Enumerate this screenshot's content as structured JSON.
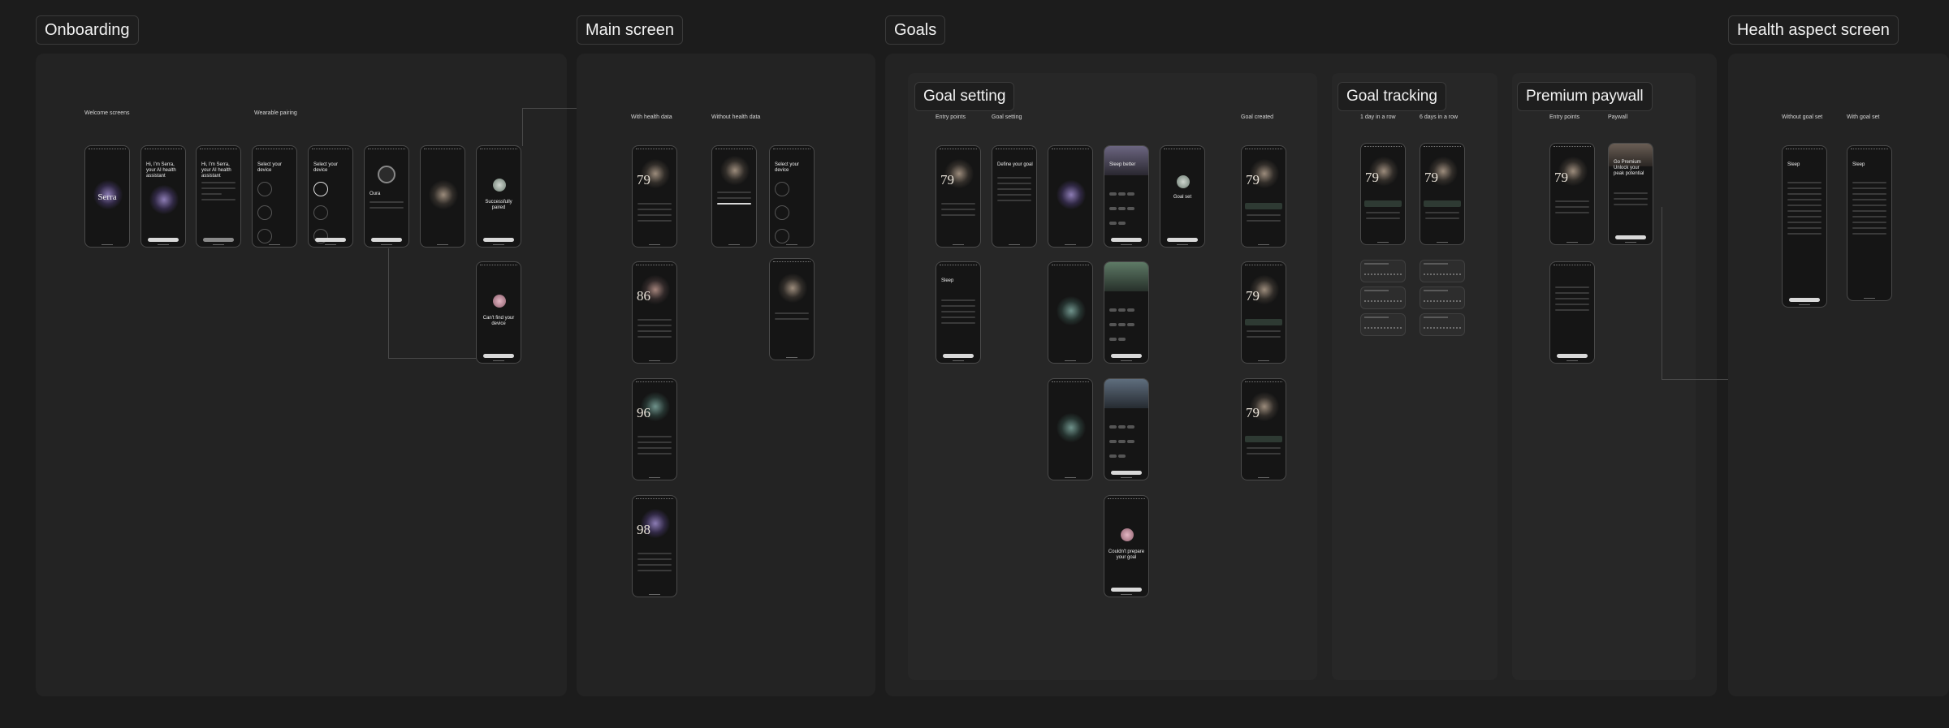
{
  "canvas": {
    "background": "#1c1c1c",
    "panel": "#232323",
    "tag_border": "#3a3a3a"
  },
  "sections": {
    "onboarding": {
      "title": "Onboarding",
      "captions": {
        "welcome": "Welcome screens",
        "wearable": "Wearable pairing"
      },
      "screens": {
        "wordmark": "Serra",
        "hi": "Hi, I'm Serra, your AI health assistant",
        "hi2": "Hi, I'm Serra, your AI health assistant",
        "select1": "Select your device",
        "select2": "Select your device",
        "oura": "Oura",
        "paired": "Successfully paired",
        "cant_find": "Can't find your device"
      }
    },
    "main": {
      "title": "Main screen",
      "captions": {
        "with": "With health data",
        "without": "Without health data"
      },
      "screens": {
        "score1": "79",
        "score2": "86",
        "score3": "96",
        "score4": "98",
        "select": "Select your device"
      }
    },
    "goals": {
      "title": "Goals",
      "goal_setting": {
        "title": "Goal setting",
        "captions": {
          "entry": "Entry points",
          "setting": "Goal setting",
          "created": "Goal created"
        },
        "screens": {
          "score": "79",
          "define": "Define your goal",
          "sleep": "Sleep better",
          "goal_set": "Goal set",
          "sleep_card": "Sleep",
          "couldnt": "Couldn't prepare your goal",
          "score_created": "79"
        }
      },
      "goal_tracking": {
        "title": "Goal tracking",
        "captions": {
          "one_day": "1 day in a row",
          "six_days": "6 days in a row"
        },
        "screens": {
          "score1": "79",
          "score2": "79"
        }
      },
      "premium": {
        "title": "Premium paywall",
        "captions": {
          "entry": "Entry points",
          "paywall": "Paywall"
        },
        "screens": {
          "score": "79",
          "go_premium": "Go Premium Unlock your peak potential"
        }
      }
    },
    "health_aspect": {
      "title": "Health aspect screen",
      "captions": {
        "without": "Without goal set",
        "with": "With goal set"
      },
      "screens": {
        "sleep1": "Sleep",
        "sleep2": "Sleep"
      }
    }
  }
}
